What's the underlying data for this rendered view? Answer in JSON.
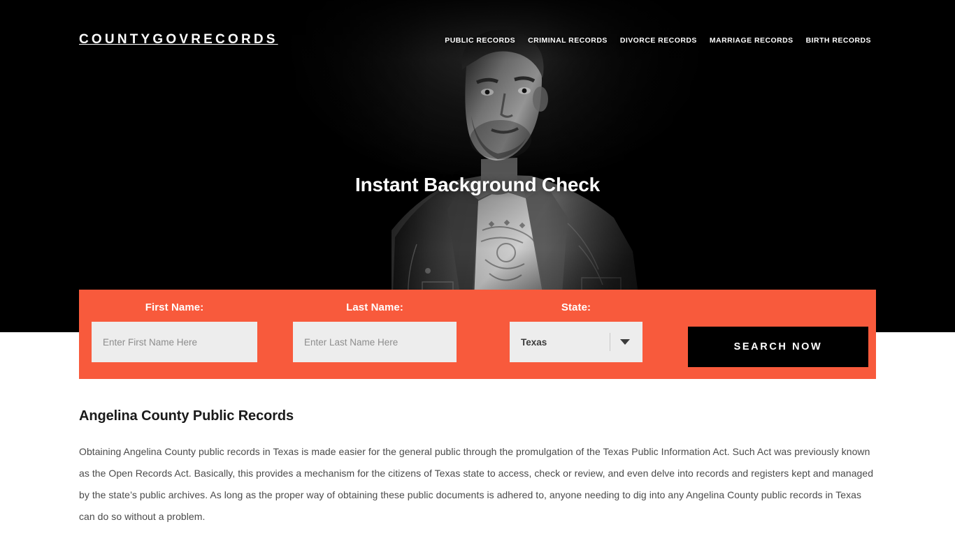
{
  "site": {
    "logo": "COUNTYGOVRECORDS",
    "accent_color": "#F85A3C",
    "hero_bg_color": "#000000",
    "button_color": "#000000",
    "input_bg_color": "#EDEDED"
  },
  "nav": {
    "items": [
      {
        "label": "PUBLIC RECORDS"
      },
      {
        "label": "CRIMINAL RECORDS"
      },
      {
        "label": "DIVORCE RECORDS"
      },
      {
        "label": "MARRIAGE RECORDS"
      },
      {
        "label": "BIRTH RECORDS"
      }
    ]
  },
  "hero": {
    "title": "Instant Background Check",
    "image_description": "black-and-white photo of a man in a denim jacket"
  },
  "search_form": {
    "first_name": {
      "label": "First Name:",
      "placeholder": "Enter First Name Here",
      "value": ""
    },
    "last_name": {
      "label": "Last Name:",
      "placeholder": "Enter Last Name Here",
      "value": ""
    },
    "state": {
      "label": "State:",
      "selected": "Texas",
      "arrow_icon": "chevron-down-icon"
    },
    "submit_label": "SEARCH NOW"
  },
  "main": {
    "heading": "Angelina County Public Records",
    "paragraph": "Obtaining Angelina County public records in Texas is made easier for the general public through the promulgation of the Texas Public Information Act. Such Act was previously known as the Open Records Act. Basically, this provides a mechanism for the citizens of Texas state to access, check or review, and even delve into records and registers kept and managed by the state’s public archives. As long as the proper way of obtaining these public documents is adhered to, anyone needing to dig into any Angelina County public records in Texas can do so without a problem."
  }
}
